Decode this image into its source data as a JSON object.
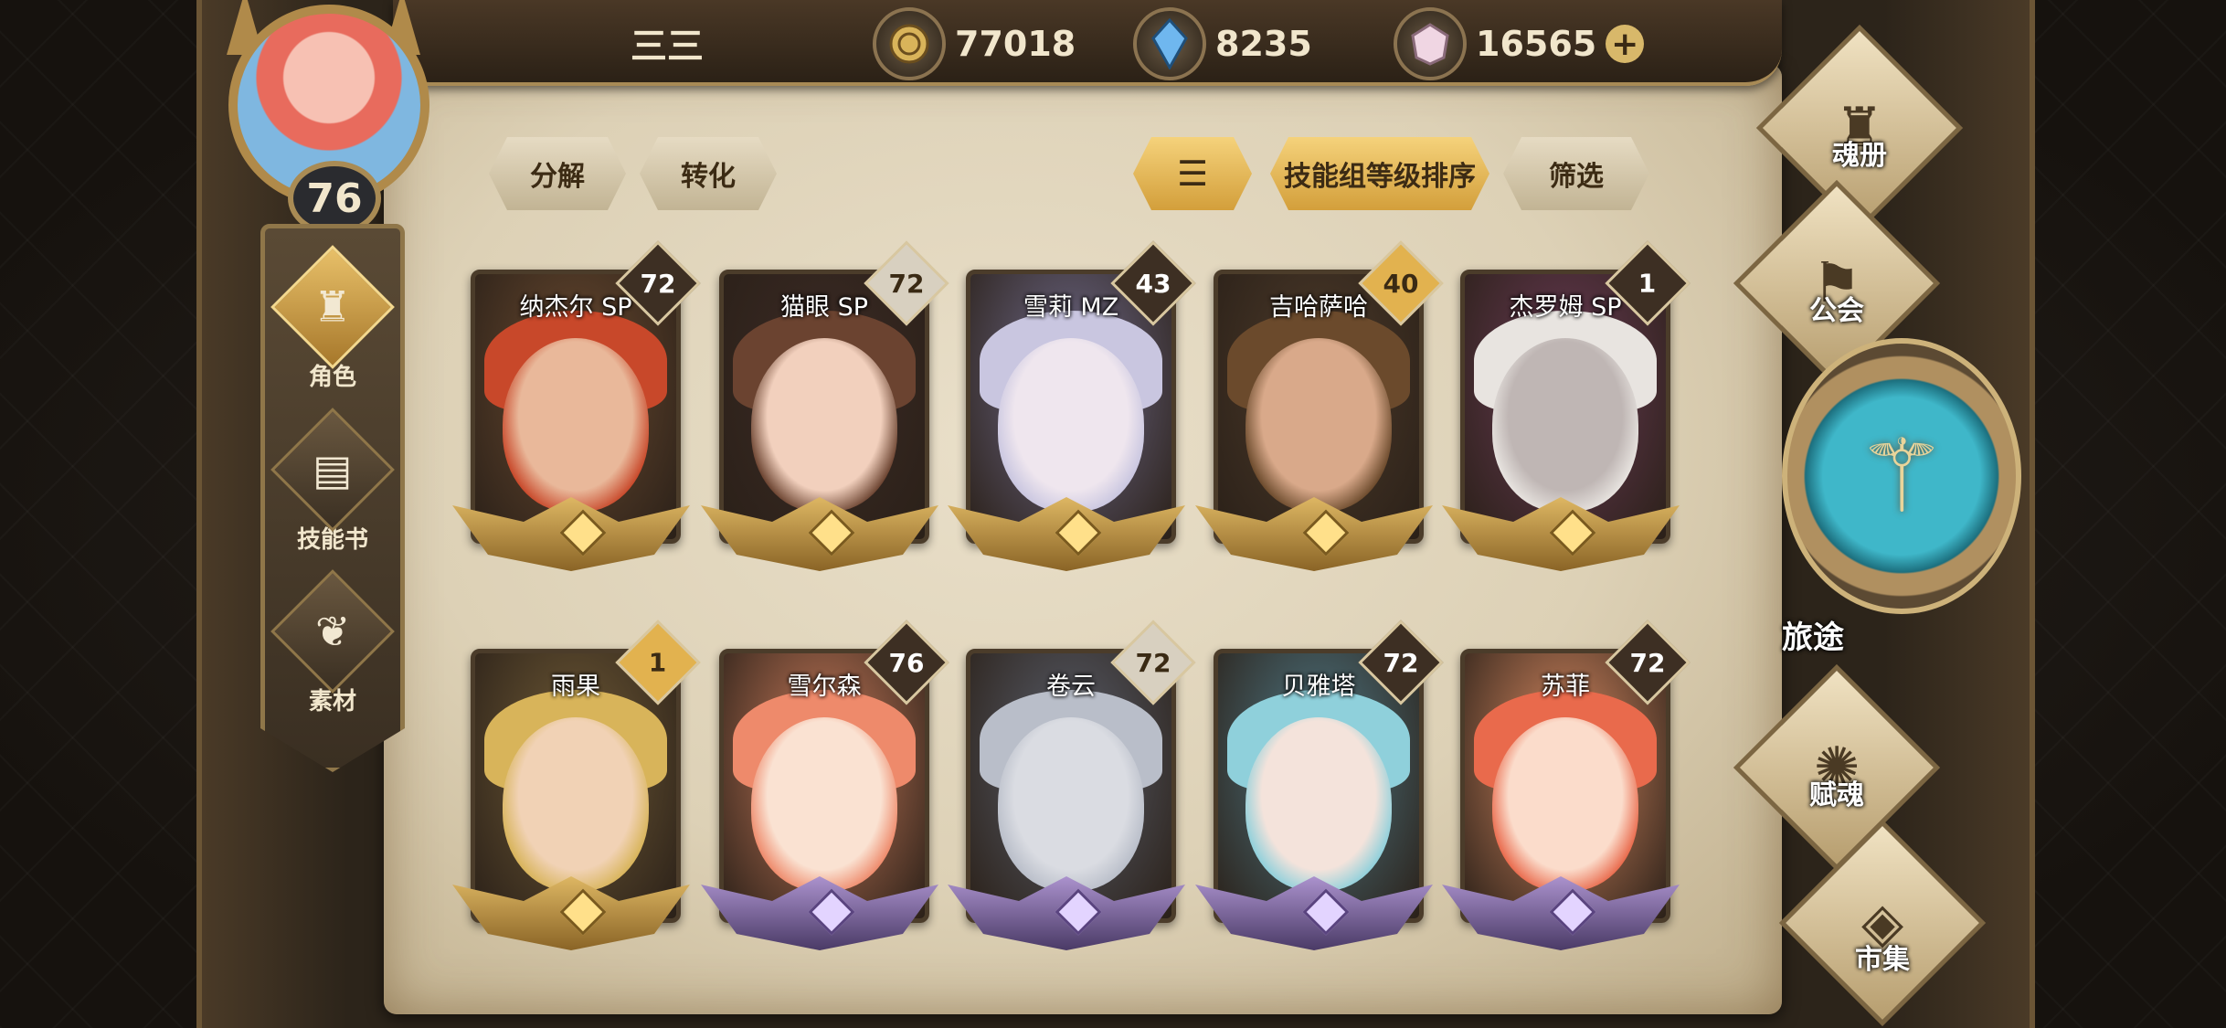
{
  "player": {
    "name": "三三",
    "level": "76"
  },
  "currencies": [
    {
      "icon": "gold-coin-icon",
      "value": "77018"
    },
    {
      "icon": "blue-crystal-icon",
      "value": "8235"
    },
    {
      "icon": "pink-gem-icon",
      "value": "16565",
      "plus": "+"
    }
  ],
  "sidebar": {
    "items": [
      {
        "label": "角色",
        "icon": "helmet-icon",
        "active": true
      },
      {
        "label": "技能书",
        "icon": "book-icon",
        "active": false
      },
      {
        "label": "素材",
        "icon": "beast-icon",
        "active": false
      }
    ]
  },
  "toolbar": {
    "decompose": "分解",
    "convert": "转化",
    "sort_label": "技能组等级排序",
    "filter": "筛选"
  },
  "heroes": [
    {
      "name": "纳杰尔 SP",
      "level": "72",
      "badge": "dark",
      "rarity": "gold",
      "hair": "#c8482a",
      "skin": "#e9b89a",
      "bg": "#6a4a30"
    },
    {
      "name": "猫眼 SP",
      "level": "72",
      "badge": "silver",
      "rarity": "gold",
      "hair": "#6b4330",
      "skin": "#f2d0bd",
      "bg": "#3b2a25"
    },
    {
      "name": "雪莉 MZ",
      "level": "43",
      "badge": "dark",
      "rarity": "gold",
      "hair": "#c9c6e0",
      "skin": "#efe6ee",
      "bg": "#6f6a8a"
    },
    {
      "name": "吉哈萨哈",
      "level": "40",
      "badge": "gold",
      "rarity": "gold",
      "hair": "#6b4a2c",
      "skin": "#d9a98a",
      "bg": "#4c3a2a"
    },
    {
      "name": "杰罗姆 SP",
      "level": "1",
      "badge": "dark",
      "rarity": "gold",
      "hair": "#e8e4e0",
      "skin": "#bfb6b4",
      "bg": "#6a3a55"
    },
    {
      "name": "雨果",
      "level": "1",
      "badge": "gold",
      "rarity": "gold",
      "hair": "#d8b45a",
      "skin": "#f1d2b5",
      "bg": "#6f5a36"
    },
    {
      "name": "雪尔森",
      "level": "76",
      "badge": "dark",
      "rarity": "purple",
      "hair": "#ee8a6b",
      "skin": "#fae2d2",
      "bg": "#c87a5a"
    },
    {
      "name": "卷云",
      "level": "72",
      "badge": "silver",
      "rarity": "purple",
      "hair": "#b9bec9",
      "skin": "#dadce2",
      "bg": "#5a5f6c"
    },
    {
      "name": "贝雅塔",
      "level": "72",
      "badge": "dark",
      "rarity": "purple",
      "hair": "#8fd0db",
      "skin": "#f4e3db",
      "bg": "#4f7885"
    },
    {
      "name": "苏菲",
      "level": "72",
      "badge": "dark",
      "rarity": "purple",
      "hair": "#e96a4c",
      "skin": "#fbdccb",
      "bg": "#d98a62"
    }
  ],
  "right_nav": {
    "soul_book": "魂册",
    "guild": "公会",
    "journey": "旅途",
    "soul_grant": "赋魂",
    "market": "市集"
  }
}
